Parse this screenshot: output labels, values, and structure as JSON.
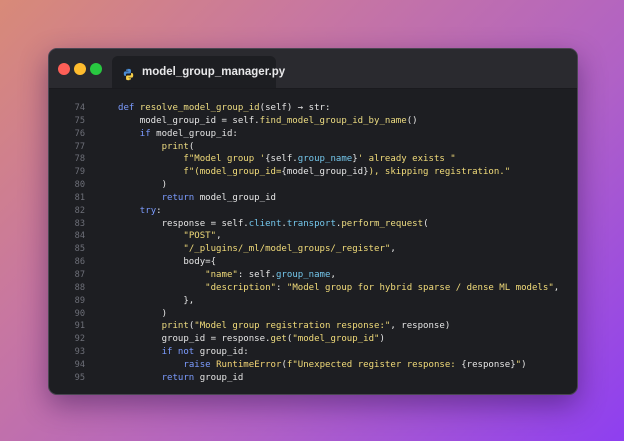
{
  "window": {
    "tab_label": "model_group_manager.py",
    "tab_icon": "python-icon"
  },
  "colors": {
    "keyword": "#7c9cff",
    "function": "#eedd82",
    "string": "#f2dc7a",
    "attribute": "#74c7ec",
    "text": "#e6e6e6",
    "line_number": "#6d6f78"
  },
  "code": {
    "lines": [
      {
        "n": "74",
        "tokens": [
          [
            "kw",
            "def "
          ],
          [
            "fn",
            "resolve_model_group_id"
          ],
          [
            "",
            "(self) → str:"
          ]
        ]
      },
      {
        "n": "75",
        "tokens": [
          [
            "",
            "    model_group_id = self."
          ],
          [
            "fn",
            "find_model_group_id_by_name"
          ],
          [
            "",
            "()"
          ]
        ]
      },
      {
        "n": "76",
        "tokens": [
          [
            "",
            "    "
          ],
          [
            "kw",
            "if"
          ],
          [
            "",
            " model_group_id:"
          ]
        ]
      },
      {
        "n": "77",
        "tokens": [
          [
            "",
            "        "
          ],
          [
            "fn",
            "print"
          ],
          [
            "",
            "("
          ]
        ]
      },
      {
        "n": "78",
        "tokens": [
          [
            "",
            "            "
          ],
          [
            "str",
            "f\"Model group '"
          ],
          [
            "",
            "{self."
          ],
          [
            "attr",
            "group_name"
          ],
          [
            "",
            "}"
          ],
          [
            "str",
            "' already exists \""
          ]
        ]
      },
      {
        "n": "79",
        "tokens": [
          [
            "",
            "            "
          ],
          [
            "str",
            "f\"(model_group_id="
          ],
          [
            "",
            "{model_group_id}"
          ],
          [
            "str",
            "), skipping registration.\""
          ]
        ]
      },
      {
        "n": "80",
        "tokens": [
          [
            "",
            "        )"
          ]
        ]
      },
      {
        "n": "81",
        "tokens": [
          [
            "",
            "        "
          ],
          [
            "kw",
            "return"
          ],
          [
            "",
            " model_group_id"
          ]
        ]
      },
      {
        "n": "82",
        "tokens": [
          [
            "",
            "    "
          ],
          [
            "kw",
            "try"
          ],
          [
            "",
            ":"
          ]
        ]
      },
      {
        "n": "83",
        "tokens": [
          [
            "",
            "        response = self."
          ],
          [
            "attr",
            "client"
          ],
          [
            "",
            "."
          ],
          [
            "attr",
            "transport"
          ],
          [
            "",
            "."
          ],
          [
            "fn",
            "perform_request"
          ],
          [
            "",
            "("
          ]
        ]
      },
      {
        "n": "84",
        "tokens": [
          [
            "",
            "            "
          ],
          [
            "str",
            "\"POST\""
          ],
          [
            "",
            ","
          ]
        ]
      },
      {
        "n": "85",
        "tokens": [
          [
            "",
            "            "
          ],
          [
            "str",
            "\"/_plugins/_ml/model_groups/_register\""
          ],
          [
            "",
            ","
          ]
        ]
      },
      {
        "n": "86",
        "tokens": [
          [
            "",
            "            body={"
          ]
        ]
      },
      {
        "n": "87",
        "tokens": [
          [
            "",
            "                "
          ],
          [
            "str",
            "\"name\""
          ],
          [
            "",
            ": self."
          ],
          [
            "attr",
            "group_name"
          ],
          [
            "",
            ","
          ]
        ]
      },
      {
        "n": "88",
        "tokens": [
          [
            "",
            "                "
          ],
          [
            "str",
            "\"description\""
          ],
          [
            "",
            ": "
          ],
          [
            "str",
            "\"Model group for hybrid sparse / dense ML models\""
          ],
          [
            "",
            ","
          ]
        ]
      },
      {
        "n": "89",
        "tokens": [
          [
            "",
            "            },"
          ]
        ]
      },
      {
        "n": "90",
        "tokens": [
          [
            "",
            "        )"
          ]
        ]
      },
      {
        "n": "91",
        "tokens": [
          [
            "",
            "        "
          ],
          [
            "fn",
            "print"
          ],
          [
            "",
            "("
          ],
          [
            "str",
            "\"Model group registration response:\""
          ],
          [
            "",
            ", response)"
          ]
        ]
      },
      {
        "n": "92",
        "tokens": [
          [
            "",
            "        group_id = response."
          ],
          [
            "fn",
            "get"
          ],
          [
            "",
            "("
          ],
          [
            "str",
            "\"model_group_id\""
          ],
          [
            "",
            ")"
          ]
        ]
      },
      {
        "n": "93",
        "tokens": [
          [
            "",
            "        "
          ],
          [
            "kw",
            "if not"
          ],
          [
            "",
            " group_id:"
          ]
        ]
      },
      {
        "n": "94",
        "tokens": [
          [
            "",
            "            "
          ],
          [
            "kw",
            "raise"
          ],
          [
            "",
            " "
          ],
          [
            "cls",
            "RuntimeError"
          ],
          [
            "",
            "("
          ],
          [
            "str",
            "f\"Unexpected register response: "
          ],
          [
            "",
            "{response}"
          ],
          [
            "str",
            "\""
          ],
          [
            "",
            ")"
          ]
        ]
      },
      {
        "n": "95",
        "tokens": [
          [
            "",
            "        "
          ],
          [
            "kw",
            "return"
          ],
          [
            "",
            " group_id"
          ]
        ]
      }
    ]
  }
}
